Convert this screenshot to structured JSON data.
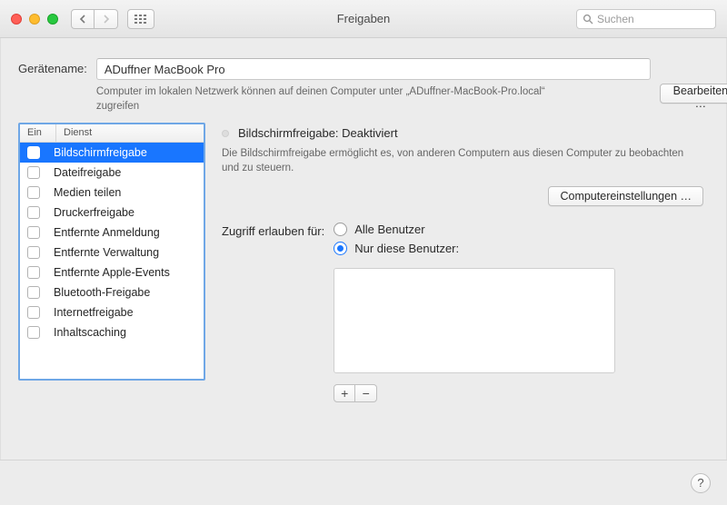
{
  "window": {
    "title": "Freigaben"
  },
  "search": {
    "placeholder": "Suchen"
  },
  "device": {
    "label": "Gerätename:",
    "value": "ADuffner MacBook Pro",
    "hint": "Computer im lokalen Netzwerk können auf deinen Computer unter „ADuffner-MacBook-Pro.local“ zugreifen",
    "edit_label": "Bearbeiten …"
  },
  "services": {
    "col_on": "Ein",
    "col_service": "Dienst",
    "items": [
      {
        "label": "Bildschirmfreigabe",
        "checked": false,
        "selected": true
      },
      {
        "label": "Dateifreigabe",
        "checked": false,
        "selected": false
      },
      {
        "label": "Medien teilen",
        "checked": false,
        "selected": false
      },
      {
        "label": "Druckerfreigabe",
        "checked": false,
        "selected": false
      },
      {
        "label": "Entfernte Anmeldung",
        "checked": false,
        "selected": false
      },
      {
        "label": "Entfernte Verwaltung",
        "checked": false,
        "selected": false
      },
      {
        "label": "Entfernte Apple-Events",
        "checked": false,
        "selected": false
      },
      {
        "label": "Bluetooth-Freigabe",
        "checked": false,
        "selected": false
      },
      {
        "label": "Internetfreigabe",
        "checked": false,
        "selected": false
      },
      {
        "label": "Inhaltscaching",
        "checked": false,
        "selected": false
      }
    ]
  },
  "detail": {
    "status": "Bildschirmfreigabe: Deaktiviert",
    "description": "Die Bildschirmfreigabe ermöglicht es, von anderen Computern aus diesen Computer zu beobachten und zu steuern.",
    "computer_settings_label": "Computereinstellungen …",
    "access_label": "Zugriff erlauben für:",
    "radio_all": "Alle Benutzer",
    "radio_only": "Nur diese Benutzer:",
    "add_label": "+",
    "remove_label": "−"
  },
  "footer": {
    "help_label": "?"
  }
}
